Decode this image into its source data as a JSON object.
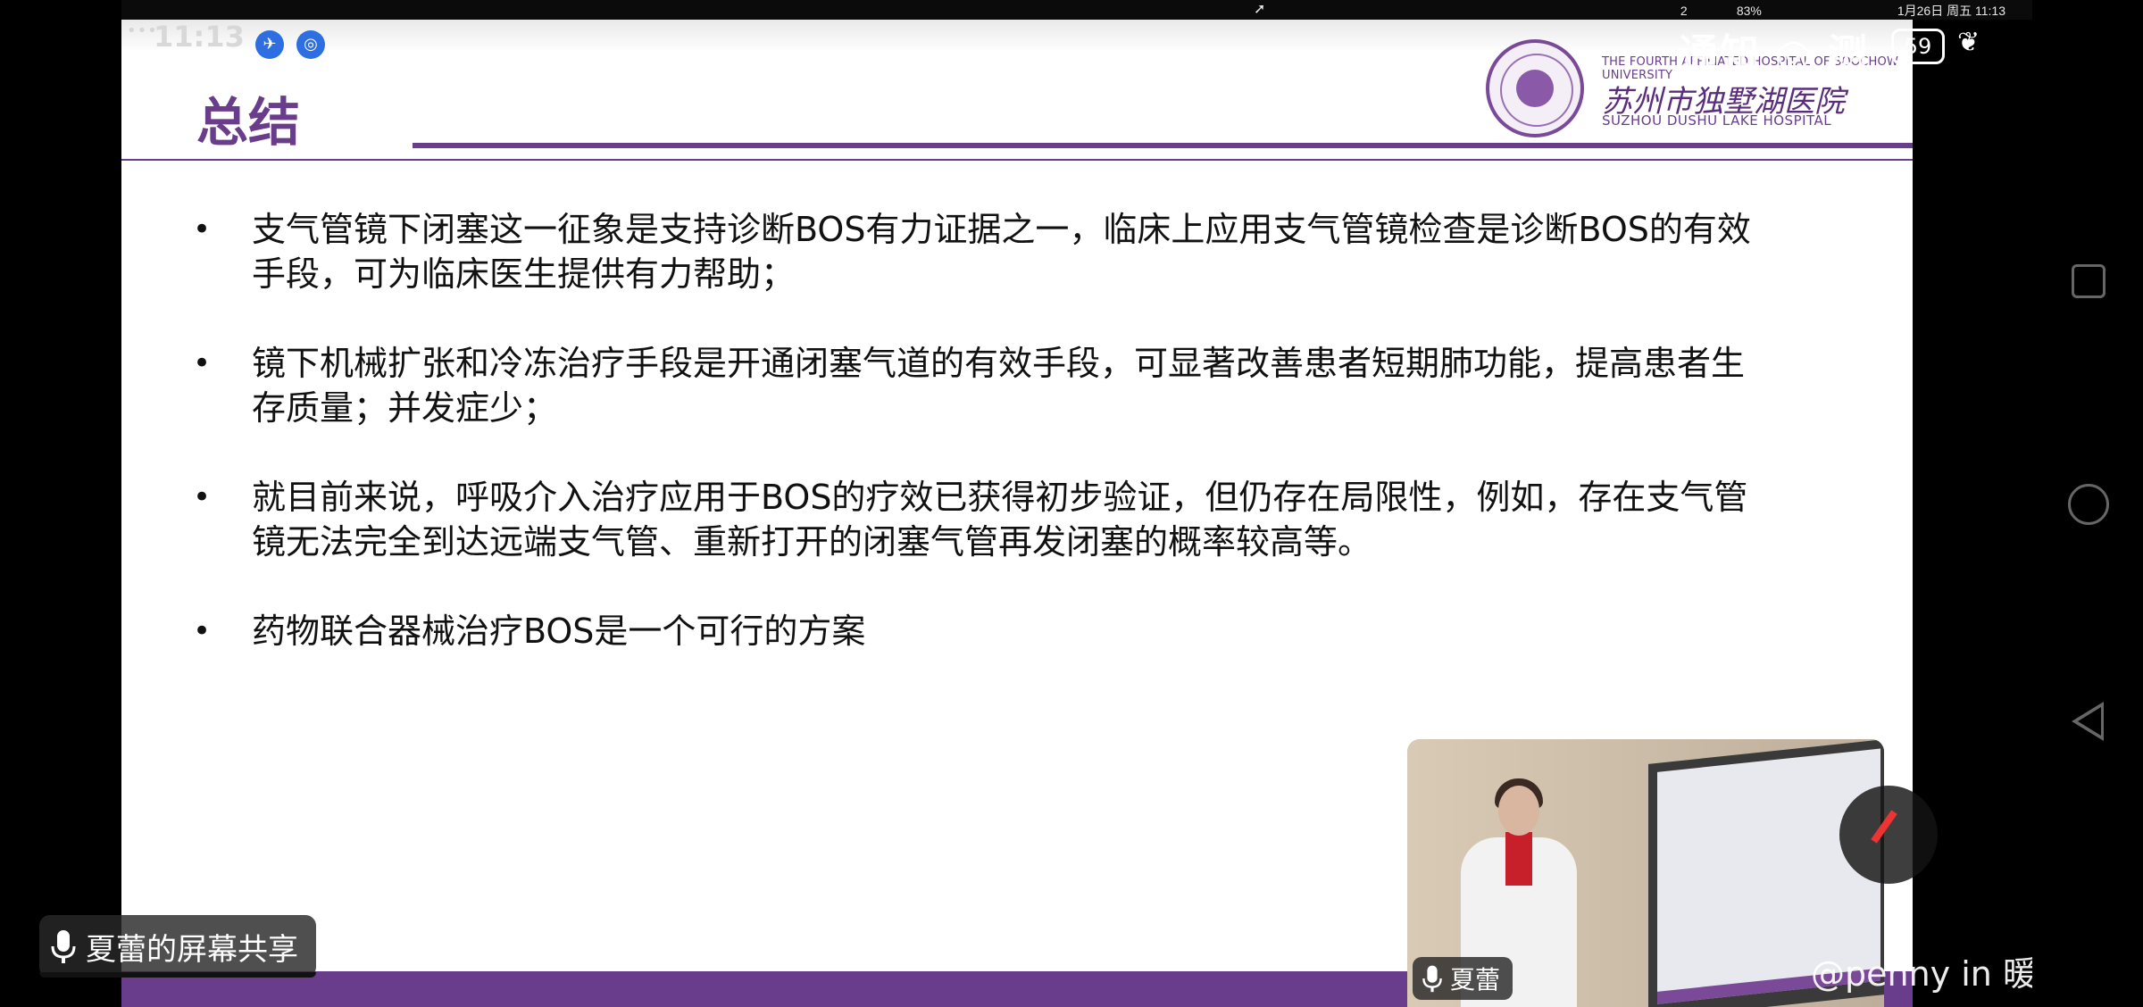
{
  "menubar": {
    "apple_icon": "apple-logo-icon",
    "status_items": [
      "",
      "",
      "2",
      "",
      "83%",
      "",
      "",
      "",
      "",
      "1月26日 周五 11:13"
    ]
  },
  "recorder": {
    "dots": "•••",
    "time": "11:13"
  },
  "slide": {
    "title": "总结",
    "logo": {
      "en_top": "THE FOURTH AFFILIATED HOSPITAL OF SOOCHOW UNIVERSITY",
      "cn": "苏州市独墅湖医院",
      "en_bottom": "SUZHOU DUSHU LAKE HOSPITAL"
    },
    "bullets": [
      "支气管镜下闭塞这一征象是支持诊断BOS有力证据之一，临床上应用支气管镜检查是诊断BOS的有效手段，可为临床医生提供有力帮助；",
      "镜下机械扩张和冷冻治疗手段是开通闭塞气道的有效手段，可显著改善患者短期肺功能，提高患者生存质量；并发症少；",
      "就目前来说，呼吸介入治疗应用于BOS的疗效已获得初步验证，但仍存在局限性，例如，存在支气管镜无法完全到达远端支气管、重新打开的闭塞气管再发闭塞的概率较高等。",
      "药物联合器械治疗BOS是一个可行的方案"
    ],
    "bullet_symbol": "•"
  },
  "share": {
    "label": "夏蕾的屏幕共享",
    "mic_icon": "microphone-icon"
  },
  "video": {
    "name": "夏蕾"
  },
  "overlay": {
    "text": "通知 ◎ 测",
    "badge": "59",
    "leaf": "❦"
  },
  "watermark": "@penny in 暖白小屋",
  "colors": {
    "accent": "#6a3c8c",
    "menubar_highlight": "#5b4fd6",
    "app_icon": "#2d6fe0"
  }
}
